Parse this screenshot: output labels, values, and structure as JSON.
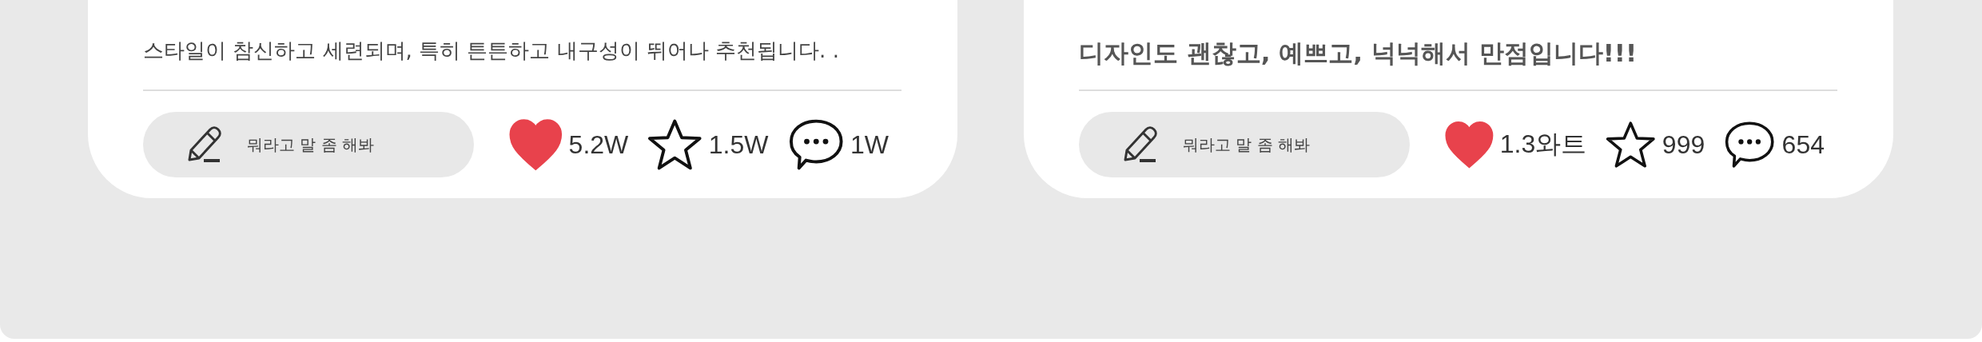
{
  "reviews": [
    {
      "text": "스타일이 참신하고 세련되며, 특히 튼튼하고 내구성이 뛰어나 추천됩니다. .",
      "bold": false,
      "comment_field": {
        "placeholder": "뭐라고 말 좀 해봐"
      },
      "liked": true,
      "likes": "5.2W",
      "starred": false,
      "stars_count": "1.5W",
      "comments": "1W"
    },
    {
      "text": "디자인도 괜찮고, 예쁘고, 넉넉해서 만점입니다!!!",
      "bold": true,
      "comment_field": {
        "placeholder": "뭐라고 말 좀 해봐"
      },
      "liked": true,
      "likes": "1.3와트",
      "starred": false,
      "stars_count": "999",
      "comments": "654"
    }
  ]
}
